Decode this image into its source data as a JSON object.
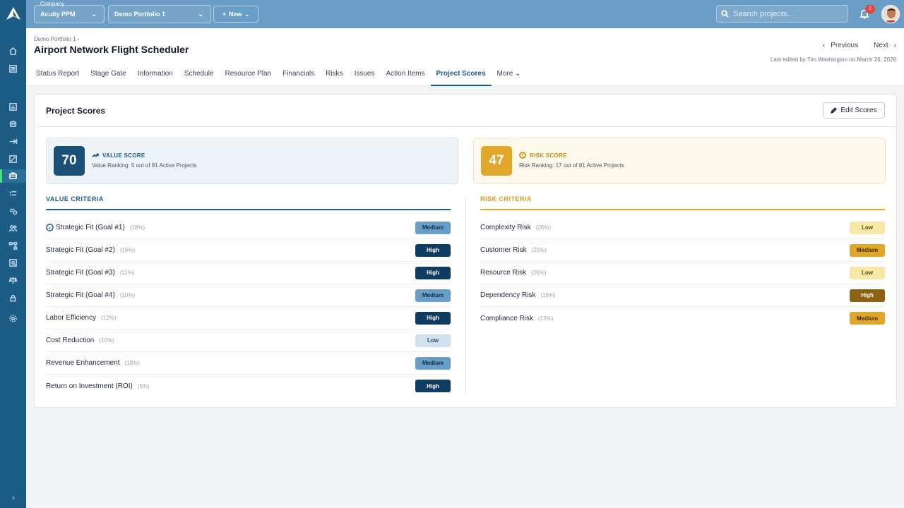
{
  "topbar": {
    "company_label": "Company",
    "company_select": "Acuity PPM",
    "portfolio_select": "Demo Portfolio 1",
    "new_label": "New",
    "search_placeholder": "Search projects...",
    "notification_count": "2"
  },
  "header": {
    "breadcrumb": "Demo Portfolio 1 ›",
    "title": "Airport Network Flight Scheduler",
    "previous_label": "Previous",
    "next_label": "Next",
    "last_edited": "Last edited by Tim Washington on March 26, 2026"
  },
  "tabs": [
    {
      "label": "Status Report"
    },
    {
      "label": "Stage Gate"
    },
    {
      "label": "Information"
    },
    {
      "label": "Schedule"
    },
    {
      "label": "Resource Plan"
    },
    {
      "label": "Financials"
    },
    {
      "label": "Risks"
    },
    {
      "label": "Issues"
    },
    {
      "label": "Action Items"
    },
    {
      "label": "Project Scores"
    },
    {
      "label": "More"
    }
  ],
  "card": {
    "title": "Project Scores",
    "edit_label": "Edit Scores"
  },
  "value_score": {
    "number": "70",
    "label": "VALUE SCORE",
    "ranking": "Value Ranking: 5 out of 81 Active Projects"
  },
  "risk_score": {
    "number": "47",
    "label": "RISK SCORE",
    "ranking": "Risk Ranking: 17 out of 81 Active Projects"
  },
  "value_criteria": {
    "heading": "VALUE CRITERIA",
    "items": [
      {
        "name": "Strategic Fit (Goal #1)",
        "weight": "(18%)",
        "level": "Medium"
      },
      {
        "name": "Strategic Fit (Goal #2)",
        "weight": "(16%)",
        "level": "High"
      },
      {
        "name": "Strategic Fit (Goal #3)",
        "weight": "(11%)",
        "level": "High"
      },
      {
        "name": "Strategic Fit (Goal #4)",
        "weight": "(10%)",
        "level": "Medium"
      },
      {
        "name": "Labor Efficiency",
        "weight": "(12%)",
        "level": "High"
      },
      {
        "name": "Cost Reduction",
        "weight": "(10%)",
        "level": "Low"
      },
      {
        "name": "Revenue Enhancement",
        "weight": "(18%)",
        "level": "Medium"
      },
      {
        "name": "Return on Investment (ROI)",
        "weight": "(5%)",
        "level": "High"
      }
    ]
  },
  "risk_criteria": {
    "heading": "RISK CRITERIA",
    "items": [
      {
        "name": "Complexity Risk",
        "weight": "(26%)",
        "level": "Low"
      },
      {
        "name": "Customer Risk",
        "weight": "(25%)",
        "level": "Medium"
      },
      {
        "name": "Resource Risk",
        "weight": "(20%)",
        "level": "Low"
      },
      {
        "name": "Dependency Risk",
        "weight": "(16%)",
        "level": "High"
      },
      {
        "name": "Compliance Risk",
        "weight": "(13%)",
        "level": "Medium"
      }
    ]
  },
  "colors": {
    "sidebar": "#1c5b83",
    "topbar": "#6b9ec6",
    "value_accent": "#1c5b83",
    "risk_accent": "#e0a72a"
  }
}
